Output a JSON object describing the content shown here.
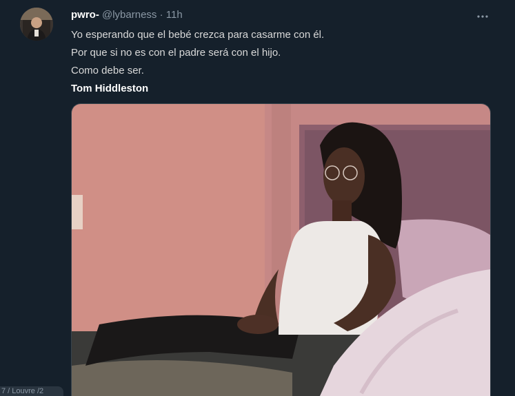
{
  "tweet": {
    "display_name": "pwro-",
    "handle": "@lybarness",
    "separator": "·",
    "time": "11h",
    "lines": [
      "Yo esperando que el bebé crezca para casarme con él.",
      "Por que si no es con el padre será con el hijo.",
      "Como debe ser."
    ],
    "bold_line": "Tom Hiddleston",
    "more_icon": "more-horizontal-icon",
    "media_description_icon": "photo-woman-on-bed"
  },
  "corner": {
    "text": "7 / Louvre /2"
  },
  "colors": {
    "background": "#15202b",
    "text": "#d9d9d9",
    "secondary": "#8b98a5",
    "name": "#ffffff"
  }
}
